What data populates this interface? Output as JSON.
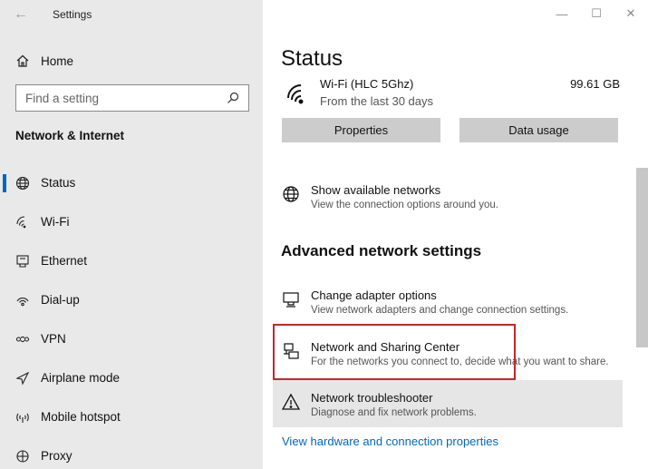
{
  "window": {
    "title": "Settings",
    "back_glyph": "←",
    "minimize_glyph": "—",
    "maximize_glyph": "☐",
    "close_glyph": "✕"
  },
  "sidebar": {
    "home_label": "Home",
    "search_placeholder": "Find a setting",
    "section_label": "Network & Internet",
    "items": [
      {
        "label": "Status",
        "icon": "globe-icon",
        "active": true
      },
      {
        "label": "Wi-Fi",
        "icon": "wifi-icon",
        "active": false
      },
      {
        "label": "Ethernet",
        "icon": "ethernet-icon",
        "active": false
      },
      {
        "label": "Dial-up",
        "icon": "dialup-icon",
        "active": false
      },
      {
        "label": "VPN",
        "icon": "vpn-icon",
        "active": false
      },
      {
        "label": "Airplane mode",
        "icon": "airplane-icon",
        "active": false
      },
      {
        "label": "Mobile hotspot",
        "icon": "hotspot-icon",
        "active": false
      },
      {
        "label": "Proxy",
        "icon": "proxy-icon",
        "active": false
      }
    ]
  },
  "main": {
    "title": "Status",
    "connection": {
      "name": "Wi-Fi (HLC 5Ghz)",
      "subtitle": "From the last 30 days",
      "usage": "99.61 GB"
    },
    "buttons": {
      "properties": "Properties",
      "data_usage": "Data usage"
    },
    "show_networks": {
      "title": "Show available networks",
      "desc": "View the connection options around you."
    },
    "advanced_title": "Advanced network settings",
    "adapter": {
      "title": "Change adapter options",
      "desc": "View network adapters and change connection settings."
    },
    "sharing": {
      "title": "Network and Sharing Center",
      "desc": "For the networks you connect to, decide what you want to share."
    },
    "troubleshooter": {
      "title": "Network troubleshooter",
      "desc": "Diagnose and fix network problems."
    },
    "link": "View hardware and connection properties"
  },
  "colors": {
    "accent": "#0067c0",
    "highlight": "#c4262e",
    "sidebar_bg": "#e9e9e9"
  }
}
